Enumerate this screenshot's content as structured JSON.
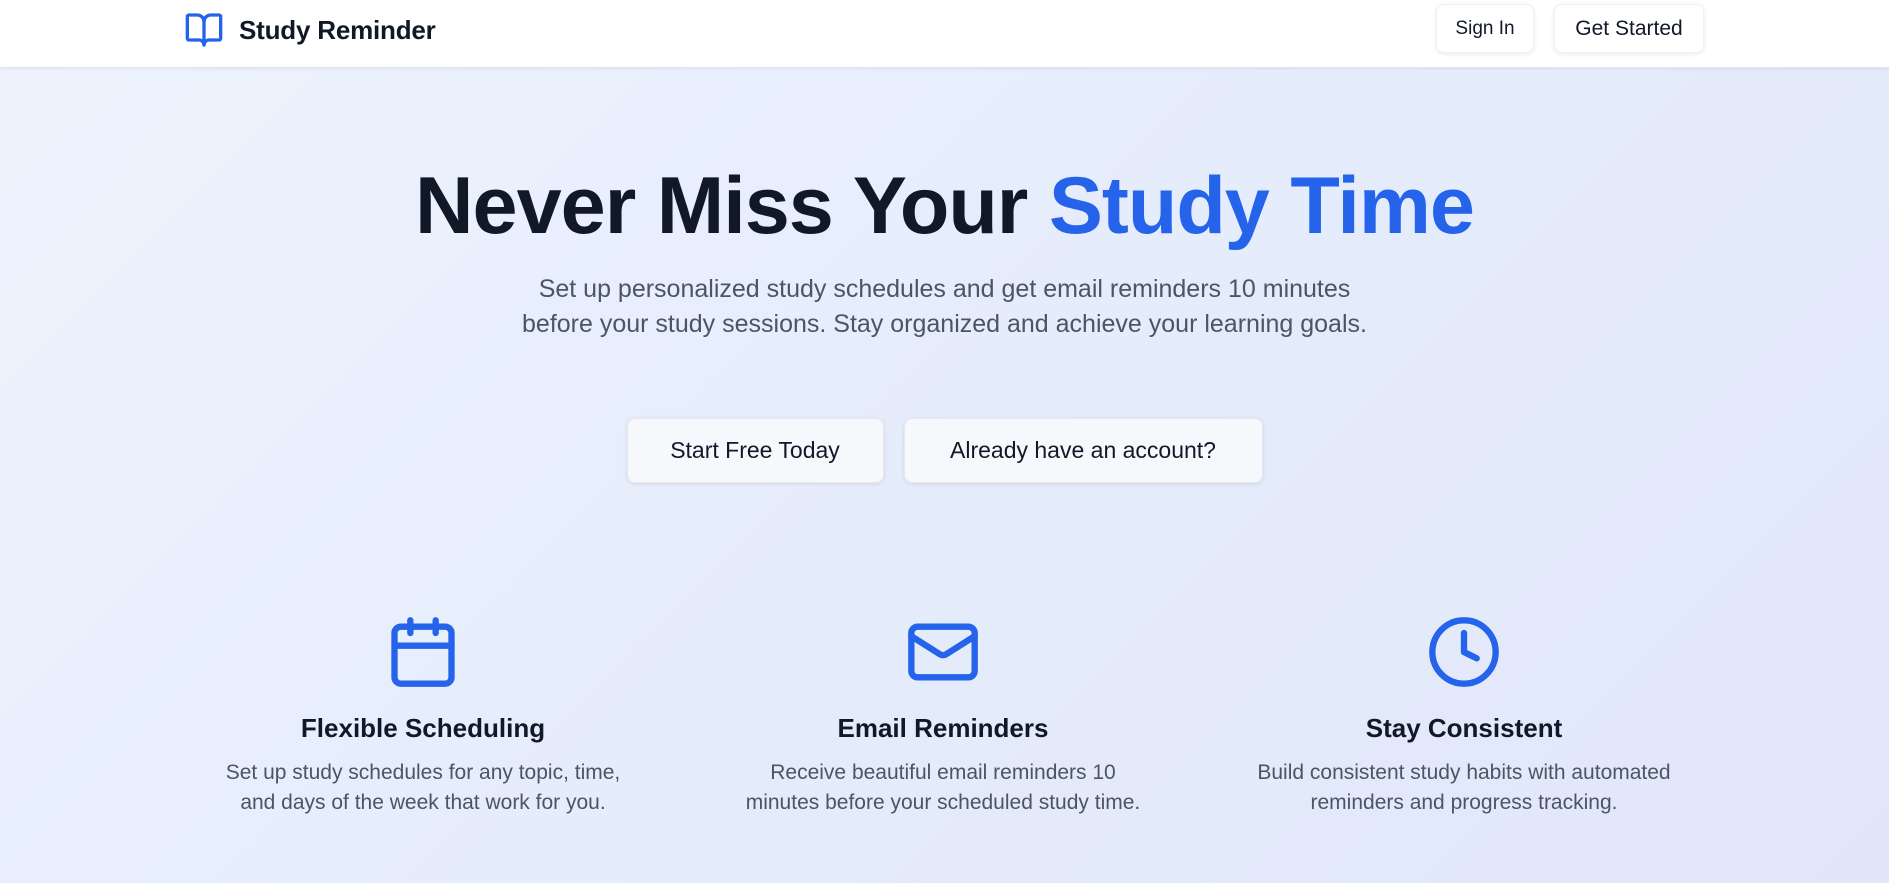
{
  "header": {
    "brand_icon": "book-open-icon",
    "brand_name": "Study Reminder",
    "sign_in_label": "Sign In",
    "get_started_label": "Get Started"
  },
  "hero": {
    "title_main": "Never Miss Your",
    "title_accent": "Study Time",
    "subtitle": "Set up personalized study schedules and get email reminders 10 minutes before your study sessions. Stay organized and achieve your learning goals.",
    "primary_cta": "Start Free Today",
    "secondary_cta": "Already have an account?"
  },
  "features": [
    {
      "icon": "calendar-icon",
      "title": "Flexible Scheduling",
      "description": "Set up study schedules for any topic, time, and days of the week that work for you."
    },
    {
      "icon": "mail-icon",
      "title": "Email Reminders",
      "description": "Receive beautiful email reminders 10 minutes before your scheduled study time."
    },
    {
      "icon": "clock-icon",
      "title": "Stay Consistent",
      "description": "Build consistent study habits with automated reminders and progress tracking."
    }
  ],
  "colors": {
    "accent": "#2563eb",
    "heading": "#111827",
    "body_text": "#4b5563",
    "header_bg": "#ffffff"
  }
}
